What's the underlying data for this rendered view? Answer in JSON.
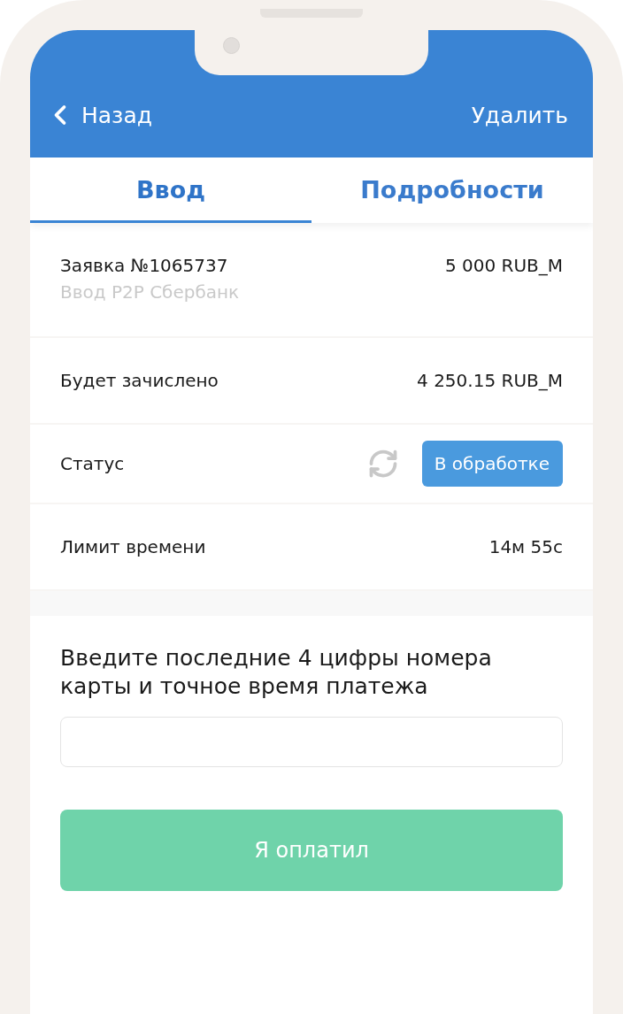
{
  "nav_bar": {
    "back": "Назад",
    "action": "Удалить"
  },
  "tabs": [
    {
      "label": "Ввод",
      "selected": true
    },
    {
      "label": "Подробности",
      "selected": false
    }
  ],
  "rows": [
    {
      "kind": "order",
      "label": "Заявка №1065737",
      "sublabel": "Ввод P2P Сбербанк",
      "value": "5 000 RUB_M"
    },
    {
      "kind": "plain",
      "label": "Будет зачислено",
      "value": "4 250.15 RUB_M"
    },
    {
      "kind": "status",
      "label": "Статус",
      "badge": "В обработке"
    },
    {
      "kind": "plain",
      "label": "Лимит времени",
      "value": "14м 55с"
    }
  ],
  "form": {
    "prompt": "Введите последние 4 цифры номера карты и точное время платежа",
    "submit": "Я оплатил"
  }
}
